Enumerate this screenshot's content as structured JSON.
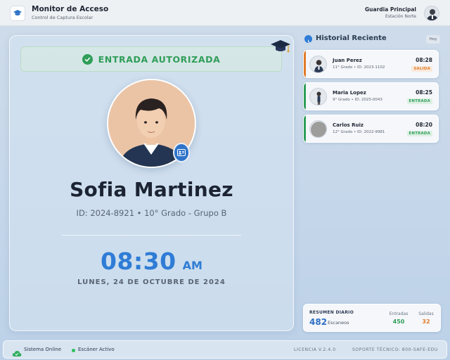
{
  "header": {
    "title": "Monitor de Acceso",
    "subtitle": "Control de Captura Escolar",
    "guard_name": "Guardia Principal",
    "guard_station": "Estación Norte",
    "logo_icon": "graduation-cap-icon",
    "avatar_icon": "guard-avatar"
  },
  "status": {
    "banner": "ENTRADA AUTORIZADA",
    "color": "#2f9e58"
  },
  "student": {
    "name": "Sofia Martinez",
    "meta": "ID: 2024-8921 • 10° Grado - Grupo B",
    "badge_icon": "id-card-icon"
  },
  "clock": {
    "time": "08:30",
    "ampm": "AM",
    "date": "LUNES, 24 DE OCTUBRE DE 2024",
    "color": "#2f7cd6"
  },
  "history": {
    "title": "Historial Reciente",
    "chip": "Hoy",
    "items": [
      {
        "name": "Juan Perez",
        "info": "11° Grado • ID: 2023-1102",
        "time": "08:28",
        "tag": "SALIDA",
        "type": "exit",
        "accent": "#e07b2a"
      },
      {
        "name": "Maria Lopez",
        "info": "9° Grado • ID: 2025-0043",
        "time": "08:25",
        "tag": "ENTRADA",
        "type": "entry",
        "accent": "#2f9e58"
      },
      {
        "name": "Carlos Ruiz",
        "info": "12° Grado • ID: 2022-9981",
        "time": "08:20",
        "tag": "ENTRADA",
        "type": "entry",
        "accent": "#2f9e58"
      }
    ]
  },
  "summary": {
    "label": "RESUMEN DIARIO",
    "count": "482",
    "count_label": "Escaneos",
    "entries_label": "Entradas",
    "entries_value": "450",
    "exits_label": "Salidas",
    "exits_value": "32"
  },
  "footer": {
    "system": "Sistema Online",
    "scanner": "Escáner Activo",
    "license": "LICENCIA V.2.4.0",
    "support": "SOPORTE TÉCNICO: 800-SAFE-EDU"
  }
}
